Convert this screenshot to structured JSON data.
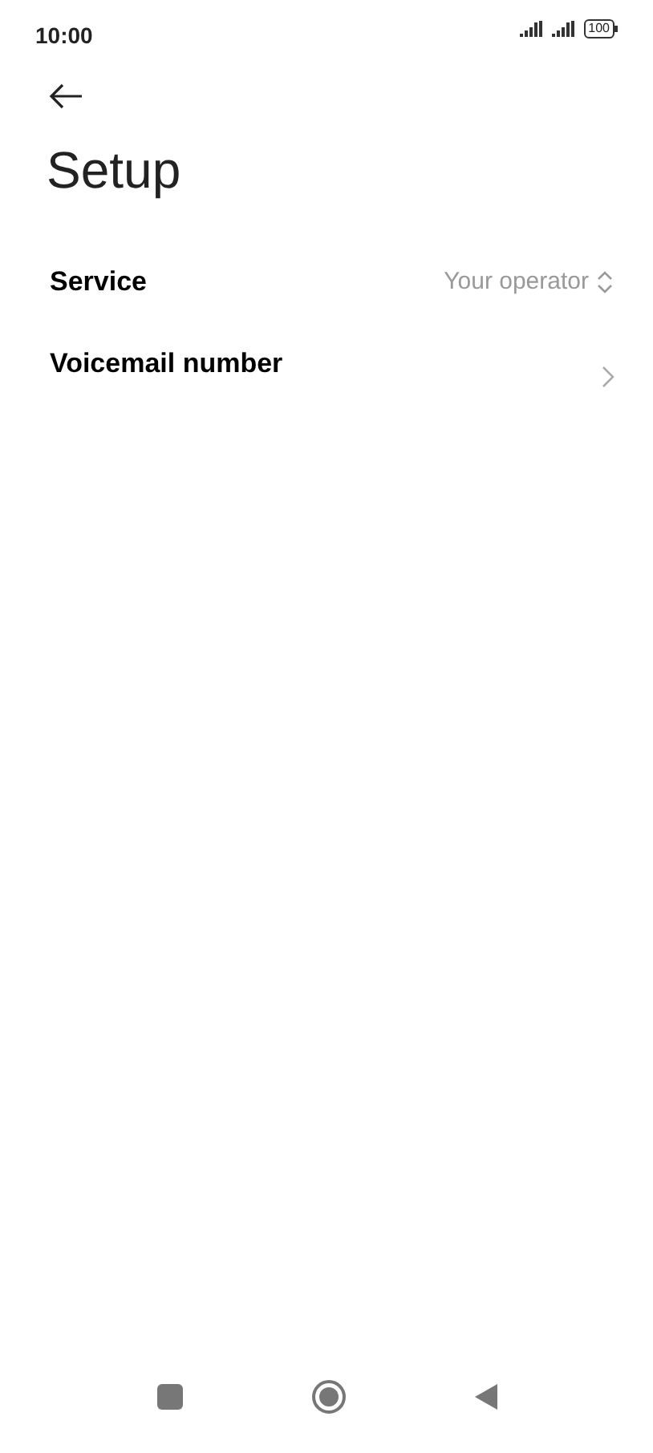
{
  "status_bar": {
    "time": "10:00",
    "battery": "100"
  },
  "title": "Setup",
  "items": [
    {
      "kind": "select",
      "label": "Service",
      "value": "Your operator"
    },
    {
      "kind": "link",
      "label": "Voicemail number"
    }
  ]
}
